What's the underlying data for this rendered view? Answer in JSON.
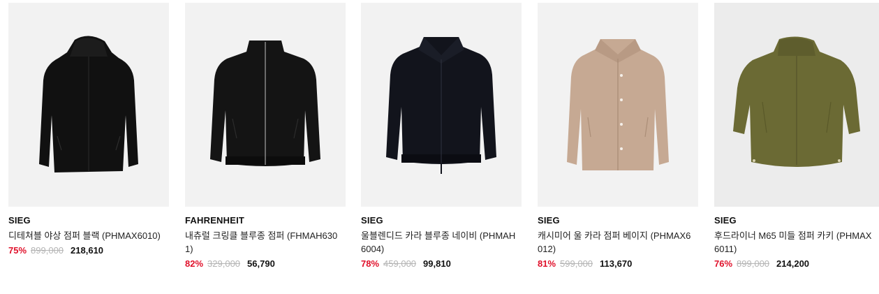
{
  "products": [
    {
      "brand": "SIEG",
      "title": "디테쳐블 야상 점퍼 블랙 (PHMAX6010)",
      "discount": "75%",
      "original_price": "899,000",
      "sale_price": "218,610",
      "image_icon": "hooded-parka-icon",
      "color": "#111111"
    },
    {
      "brand": "FAHRENHEIT",
      "title": "내츄럴 크링클 블루종 점퍼 (FHMAH6301)",
      "discount": "82%",
      "original_price": "329,000",
      "sale_price": "56,790",
      "image_icon": "blouson-jacket-icon",
      "color": "#161616"
    },
    {
      "brand": "SIEG",
      "title": "울블렌디드 카라 블루종 네이비 (PHMAH6004)",
      "discount": "78%",
      "original_price": "459,000",
      "sale_price": "99,810",
      "image_icon": "collar-blouson-icon",
      "color": "#12141c"
    },
    {
      "brand": "SIEG",
      "title": "캐시미어 울 카라 점퍼 베이지 (PHMAX6012)",
      "discount": "81%",
      "original_price": "599,000",
      "sale_price": "113,670",
      "image_icon": "coach-jacket-icon",
      "color": "#c6a993"
    },
    {
      "brand": "SIEG",
      "title": "후드라이너 M65 미들 점퍼 카키 (PHMAX6011)",
      "discount": "76%",
      "original_price": "899,000",
      "sale_price": "214,200",
      "image_icon": "m65-hooded-jacket-icon",
      "color": "#6b6a34"
    }
  ]
}
